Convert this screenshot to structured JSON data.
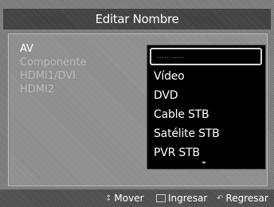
{
  "dialog": {
    "title": "Editar Nombre"
  },
  "sources": [
    {
      "label": "AV",
      "active": true
    },
    {
      "label": "Componente",
      "active": false
    },
    {
      "label": "HDMI1/DVI",
      "active": false
    },
    {
      "label": "HDMI2",
      "active": false
    }
  ],
  "dropdown": {
    "current_value": "----- -----",
    "options": [
      "Vídeo",
      "DVD",
      "Cable STB",
      "Satélite STB",
      "PVR STB"
    ]
  },
  "footer": {
    "move_label": "Mover",
    "enter_label": "Ingresar",
    "return_label": "Regresar"
  },
  "icons": {
    "move": "up-down-arrows-icon",
    "enter": "enter-icon",
    "return": "return-arrow-icon",
    "scroll": "scroll-down-arrow-icon"
  }
}
